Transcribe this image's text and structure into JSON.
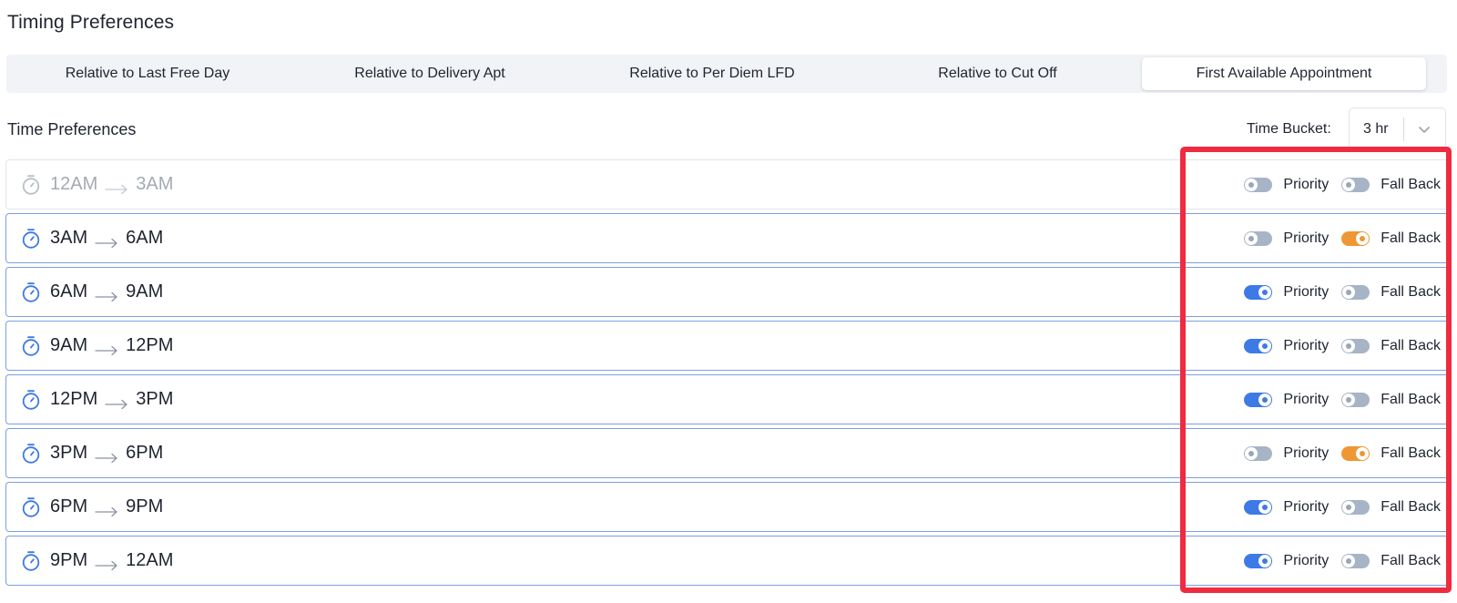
{
  "header": {
    "title": "Timing Preferences"
  },
  "tabs": [
    {
      "label": "Relative to Last Free Day",
      "active": false
    },
    {
      "label": "Relative to Delivery Apt",
      "active": false
    },
    {
      "label": "Relative to Per Diem LFD",
      "active": false
    },
    {
      "label": "Relative to Cut Off",
      "active": false
    },
    {
      "label": "First Available Appointment",
      "active": true
    }
  ],
  "time_preferences": {
    "title": "Time Preferences",
    "bucket_label": "Time Bucket:",
    "bucket_value": "3 hr",
    "priority_label": "Priority",
    "fallback_label": "Fall Back",
    "rows": [
      {
        "from": "12AM",
        "to": "3AM",
        "disabled": true,
        "priority": false,
        "fallback": false
      },
      {
        "from": "3AM",
        "to": "6AM",
        "disabled": false,
        "priority": false,
        "fallback": true
      },
      {
        "from": "6AM",
        "to": "9AM",
        "disabled": false,
        "priority": true,
        "fallback": false
      },
      {
        "from": "9AM",
        "to": "12PM",
        "disabled": false,
        "priority": true,
        "fallback": false
      },
      {
        "from": "12PM",
        "to": "3PM",
        "disabled": false,
        "priority": true,
        "fallback": false
      },
      {
        "from": "3PM",
        "to": "6PM",
        "disabled": false,
        "priority": false,
        "fallback": true
      },
      {
        "from": "6PM",
        "to": "9PM",
        "disabled": false,
        "priority": true,
        "fallback": false
      },
      {
        "from": "9PM",
        "to": "12AM",
        "disabled": false,
        "priority": true,
        "fallback": false
      }
    ]
  },
  "colors": {
    "accent_blue": "#3d7ae5",
    "fallback_orange": "#ee9734",
    "highlight_red": "#ef2b3f",
    "toggle_off": "#a7b4c6"
  },
  "icons": {
    "row_icon": "stopwatch-icon",
    "arrow": "arrow-right-icon",
    "bucket_chevron": "chevron-down-icon"
  }
}
